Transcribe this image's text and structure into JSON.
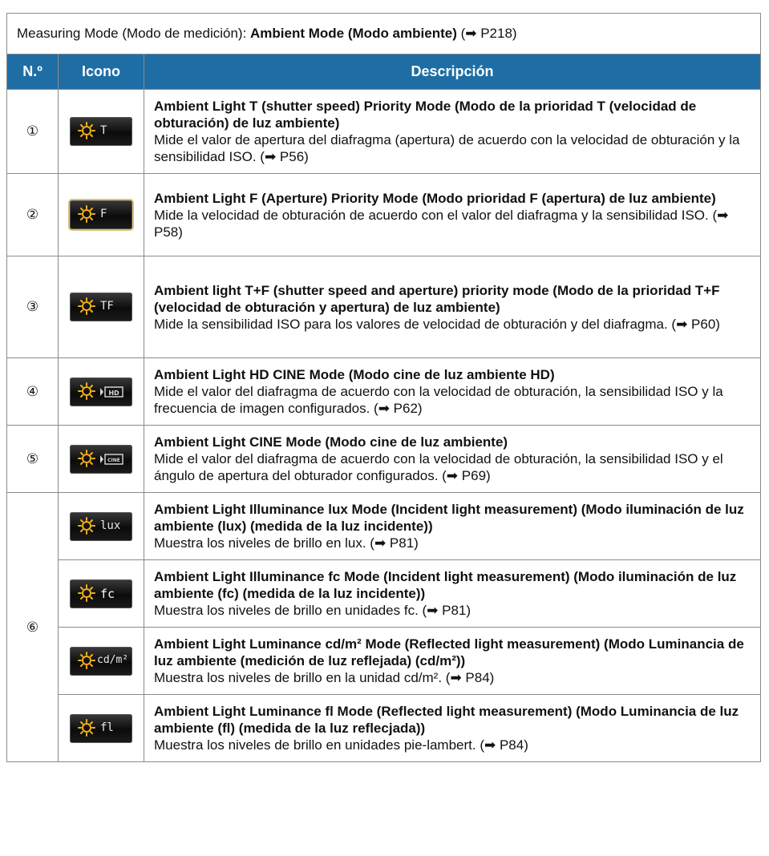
{
  "caption": {
    "prefix": "Measuring Mode (Modo de medición): ",
    "mode": "Ambient Mode (Modo ambiente)",
    "ref": " (➡ P218)"
  },
  "headers": {
    "num": "N.º",
    "icon": "Icono",
    "desc": "Descripción"
  },
  "rows": [
    {
      "num": "①",
      "icon": "ambient-T-icon",
      "icon_text": "T",
      "title": "Ambient Light T (shutter speed) Priority Mode (Modo de la prioridad T (velocidad de obturación) de luz ambiente)",
      "body": "Mide el valor de apertura del diafragma (apertura) de acuerdo con la velocidad de obturación y la sensibilidad ISO. (➡ P56)"
    },
    {
      "num": "②",
      "icon": "ambient-F-icon",
      "icon_text": "F",
      "title": "Ambient Light F (Aperture) Priority Mode (Modo prioridad F (apertura) de luz ambiente)",
      "body": "Mide la velocidad de obturación de acuerdo con el valor del diafragma y la sensibilidad ISO. (➡ P58)"
    },
    {
      "num": "③",
      "icon": "ambient-TF-icon",
      "icon_text": "TF",
      "title": "Ambient light T+F (shutter speed and aperture) priority mode (Modo de la prioridad T+F (velocidad de obturación y apertura) de luz ambiente)",
      "body": "Mide la sensibilidad ISO para los valores de velocidad de obturación y del diafragma. (➡ P60)"
    },
    {
      "num": "④",
      "icon": "ambient-hd-cine-icon",
      "icon_text": "HD",
      "title": "Ambient Light HD CINE Mode (Modo cine de luz ambiente HD)",
      "body": "Mide el valor del diafragma de acuerdo con la velocidad de obturación, la sensibilidad ISO y la frecuencia de imagen configurados. (➡ P62)"
    },
    {
      "num": "⑤",
      "icon": "ambient-cine-icon",
      "icon_text": "CINE",
      "title": "Ambient Light CINE Mode (Modo cine de luz ambiente)",
      "body": "Mide el valor del diafragma de acuerdo con la velocidad de obturación, la sensibilidad ISO y el ángulo de apertura del obturador configurados. (➡ P69)"
    },
    {
      "num": "⑥",
      "icon": "ambient-lux-icon",
      "icon_text": "lux",
      "title": "Ambient Light Illuminance lux Mode (Incident light measurement) (Modo iluminación de luz ambiente (lux) (medida de la luz incidente))",
      "body": "Muestra los niveles de brillo en lux. (➡ P81)"
    },
    {
      "num": "",
      "icon": "ambient-fc-icon",
      "icon_text": "fc",
      "title": "Ambient Light Illuminance fc Mode (Incident light measurement) (Modo iluminación de luz ambiente (fc) (medida de la luz incidente))",
      "body": "Muestra los niveles de brillo en unidades fc. (➡ P81)"
    },
    {
      "num": "",
      "icon": "ambient-cdm2-icon",
      "icon_text": "cd/m²",
      "title": "Ambient Light Luminance cd/m² Mode (Reflected light measurement) (Modo Luminancia de luz ambiente (medición de luz reflejada) (cd/m²))",
      "body": "Muestra los niveles de brillo en la unidad cd/m². (➡ P84)"
    },
    {
      "num": "",
      "icon": "ambient-fl-icon",
      "icon_text": "fl",
      "title": "Ambient Light Luminance fl Mode (Reflected light measurement) (Modo Luminancia de luz ambiente (fl) (medida de la luz reflecjada))",
      "body": "Muestra los niveles de brillo en unidades pie-lambert. (➡ P84)"
    }
  ],
  "colors": {
    "header_bg": "#1e6ea5",
    "header_text": "#ffffff",
    "sun": "#f2b01e",
    "border": "#8a8a8a"
  }
}
